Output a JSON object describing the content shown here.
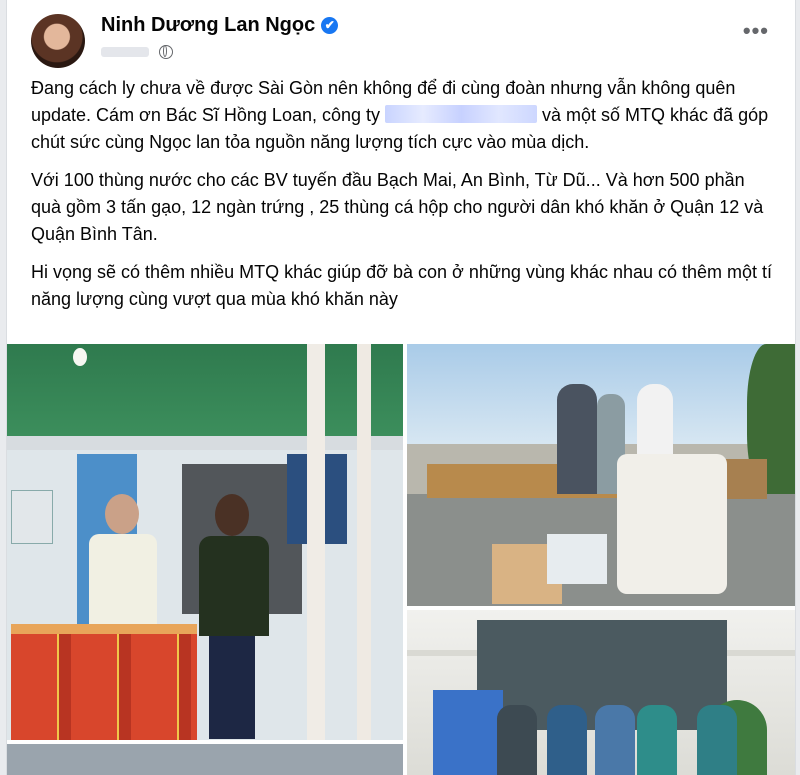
{
  "post": {
    "author": "Ninh Dương Lan Ngọc",
    "verified_glyph": "✔",
    "more_label": "•••",
    "paragraphs": [
      {
        "before": "Đang cách ly chưa về được Sài Gòn nên không để đi cùng đoàn nhưng vẫn không quên update. Cám ơn Bác Sĩ Hồng Loan, công ty ",
        "after": " và một số MTQ khác đã góp chút sức cùng Ngọc lan tỏa nguồn năng lượng tích cực vào mùa dịch."
      },
      {
        "text": "Với 100 thùng nước cho các BV tuyến đầu Bạch Mai, An Bình, Từ Dũ... Và hơn 500 phần quà gồm 3 tấn gạo, 12 ngàn trứng , 25 thùng cá hộp cho người dân khó khăn ở Quận 12 và Quận Bình Tân."
      },
      {
        "text": "Hi vọng sẽ có thêm nhiều MTQ khác giúp đỡ bà con ở những vùng khác nhau có thêm một tí năng lượng cùng vượt qua mùa khó khăn này"
      }
    ]
  },
  "icons": {
    "verified": "verified-badge-icon",
    "audience": "globe-icon",
    "more": "more-options-icon"
  },
  "colors": {
    "verified_badge": "#1877f2",
    "text": "#050505",
    "secondary_text": "#65676b"
  }
}
